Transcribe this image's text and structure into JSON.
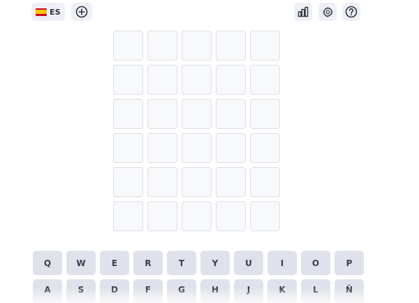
{
  "header": {
    "language": {
      "code": "ES",
      "flag": "spain-flag"
    },
    "icons": {
      "add": "plus-circle-icon",
      "stats": "bar-chart-icon",
      "settings": "gear-icon",
      "help": "help-circle-icon"
    }
  },
  "board": {
    "rows": 6,
    "cols": 5,
    "tiles": [
      [
        "",
        "",
        "",
        "",
        ""
      ],
      [
        "",
        "",
        "",
        "",
        ""
      ],
      [
        "",
        "",
        "",
        "",
        ""
      ],
      [
        "",
        "",
        "",
        "",
        ""
      ],
      [
        "",
        "",
        "",
        "",
        ""
      ],
      [
        "",
        "",
        "",
        "",
        ""
      ]
    ]
  },
  "keyboard": {
    "rows": [
      [
        "Q",
        "W",
        "E",
        "R",
        "T",
        "Y",
        "U",
        "I",
        "O",
        "P"
      ],
      [
        "A",
        "S",
        "D",
        "F",
        "G",
        "H",
        "J",
        "K",
        "L",
        "Ñ"
      ]
    ]
  },
  "colors": {
    "tile_border": "#dcdfe6",
    "key_bg": "#dfe2ea",
    "button_bg": "#eef0f5",
    "text": "#3a3f4b"
  }
}
